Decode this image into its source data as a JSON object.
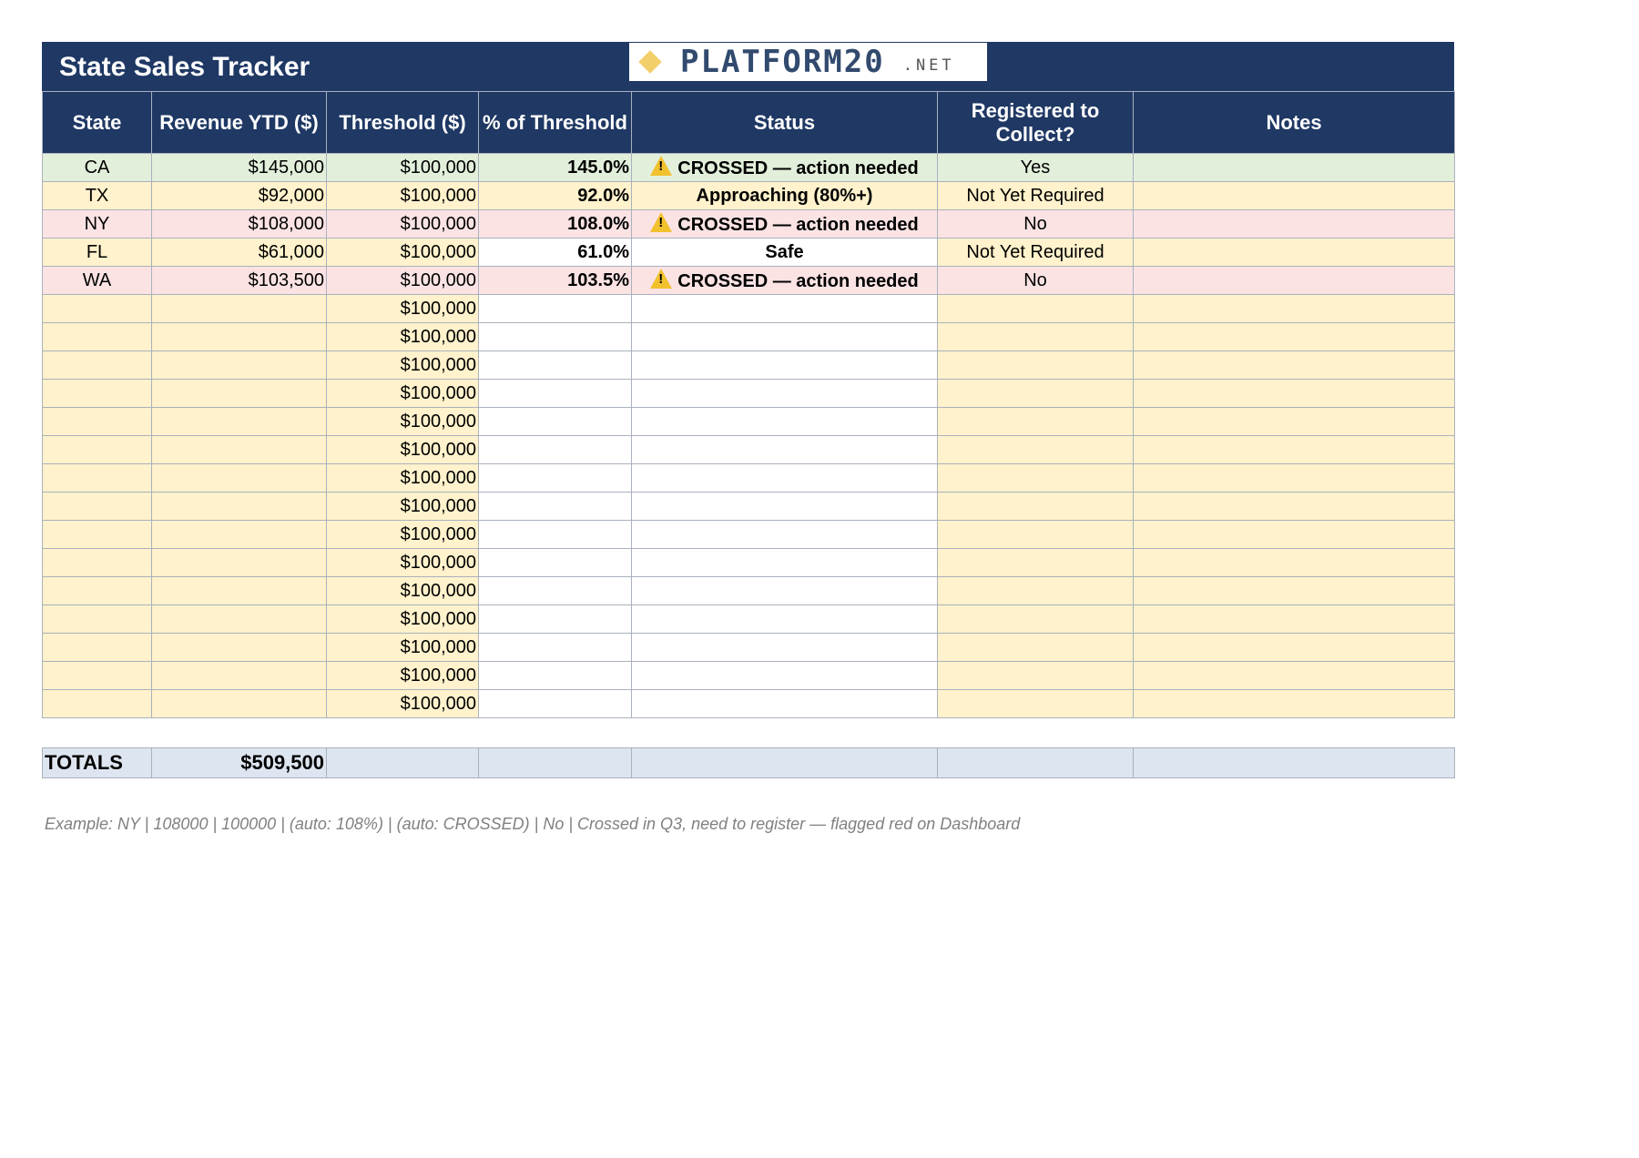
{
  "title": "State Sales Tracker",
  "logo": {
    "name": "PLATFORM20",
    "suffix": ".NET"
  },
  "columns": [
    "State",
    "Revenue YTD ($)",
    "Threshold ($)",
    "% of Threshold",
    "Status",
    "Registered to Collect?",
    "Notes"
  ],
  "rows": [
    {
      "state": "CA",
      "revenue": "$145,000",
      "threshold": "$100,000",
      "pct": "145.0%",
      "status": "CROSSED — action needed",
      "registered": "Yes",
      "notes": ""
    },
    {
      "state": "TX",
      "revenue": "$92,000",
      "threshold": "$100,000",
      "pct": "92.0%",
      "status": "Approaching (80%+)",
      "registered": "Not Yet Required",
      "notes": ""
    },
    {
      "state": "NY",
      "revenue": "$108,000",
      "threshold": "$100,000",
      "pct": "108.0%",
      "status": "CROSSED — action needed",
      "registered": "No",
      "notes": ""
    },
    {
      "state": "FL",
      "revenue": "$61,000",
      "threshold": "$100,000",
      "pct": "61.0%",
      "status": "Safe",
      "registered": "Not Yet Required",
      "notes": ""
    },
    {
      "state": "WA",
      "revenue": "$103,500",
      "threshold": "$100,000",
      "pct": "103.5%",
      "status": "CROSSED — action needed",
      "registered": "No",
      "notes": ""
    }
  ],
  "empty_threshold": "$100,000",
  "totals": {
    "label": "TOTALS",
    "revenue": "$509,500"
  },
  "example_note": "Example: NY | 108000 | 100000 | (auto: 108%) | (auto: CROSSED) | No | Crossed in Q3, need to register — flagged red on Dashboard"
}
